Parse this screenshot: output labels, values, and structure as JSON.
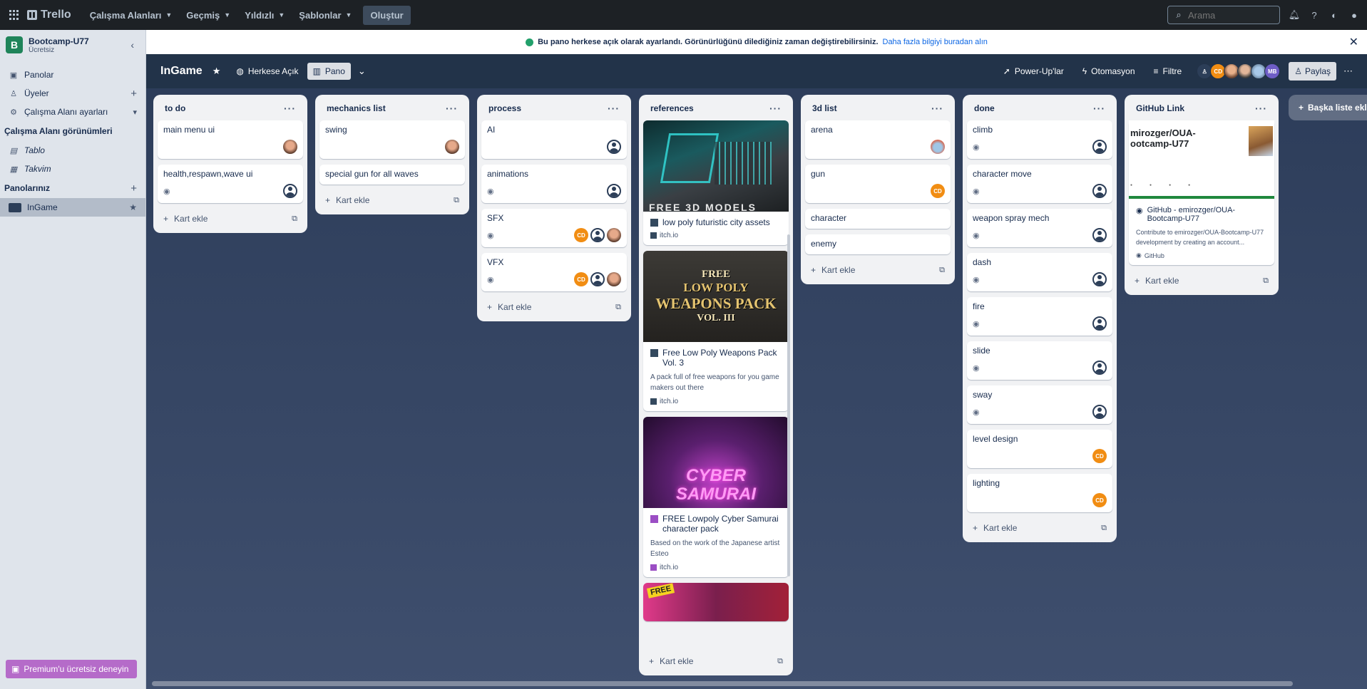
{
  "topbar": {
    "logo": "Trello",
    "nav": [
      "Çalışma Alanları",
      "Geçmiş",
      "Yıldızlı",
      "Şablonlar"
    ],
    "create": "Oluştur",
    "search_placeholder": "Arama"
  },
  "sidebar": {
    "workspace_badge": "B",
    "workspace_name": "Bootcamp-U77",
    "workspace_plan": "Ücretsiz",
    "items": [
      {
        "label": "Panolar"
      },
      {
        "label": "Üyeler"
      },
      {
        "label": "Çalışma Alanı ayarları"
      }
    ],
    "views_heading": "Çalışma Alanı görünümleri",
    "views": [
      {
        "label": "Tablo"
      },
      {
        "label": "Takvim"
      }
    ],
    "boards_heading": "Panolarınız",
    "boards": [
      {
        "label": "InGame"
      }
    ],
    "premium": "Premium'u ücretsiz deneyin"
  },
  "banner": {
    "text": "Bu pano herkese açık olarak ayarlandı. Görünürlüğünü dilediğiniz zaman değiştirebilirsiniz.",
    "link": "Daha fazla bilgiyi buradan alın"
  },
  "board": {
    "title": "InGame",
    "visibility": "Herkese Açık",
    "view": "Pano",
    "powerups": "Power-Up'lar",
    "automation": "Otomasyon",
    "filter": "Filtre",
    "share": "Paylaş",
    "avatar_cd": "CD",
    "avatar_mb": "MB"
  },
  "common": {
    "add_card": "Kart ekle",
    "add_list": "Başka liste ekleyin",
    "cd": "CD"
  },
  "lists": {
    "todo": {
      "title": "to do",
      "cards": [
        "main menu ui",
        "health,respawn,wave ui"
      ]
    },
    "mechanics": {
      "title": "mechanics list",
      "cards": [
        "swing",
        "special gun for all waves"
      ]
    },
    "process": {
      "title": "process",
      "cards": [
        "AI",
        "animations",
        "SFX",
        "VFX"
      ]
    },
    "references": {
      "title": "references",
      "cards": [
        {
          "title": "low poly futuristic city assets",
          "source": "itch.io",
          "img_text": "FREE 3D MODELS"
        },
        {
          "title": "Free Low Poly Weapons Pack Vol. 3",
          "desc": "A pack full of free weapons for you game makers out there",
          "source": "itch.io",
          "img_lines": [
            "FREE",
            "LOW POLY",
            "WEAPONS PACK",
            "VOL. III"
          ]
        },
        {
          "title": "FREE Lowpoly Cyber Samurai character pack",
          "desc": "Based on the work of the Japanese artist Esteo",
          "source": "itch.io",
          "img_lines": [
            "CYBER",
            "SAMURAI"
          ]
        },
        {
          "img_text": "FREE"
        }
      ]
    },
    "list3d": {
      "title": "3d list",
      "cards": [
        "arena",
        "gun",
        "character",
        "enemy"
      ]
    },
    "done": {
      "title": "done",
      "cards": [
        "climb",
        "character move",
        "weapon spray mech",
        "dash",
        "fire",
        "slide",
        "sway",
        "level design",
        "lighting"
      ]
    },
    "github": {
      "title": "GitHub Link",
      "preview_title": "mirozger/OUA-\nootcamp-U77",
      "card_title": "GitHub - emirozger/OUA-Bootcamp-U77",
      "card_desc": "Contribute to emirozger/OUA-Bootcamp-U77 development by creating an account...",
      "source": "GitHub"
    }
  },
  "colors": {
    "accent": "#0c66e4",
    "cd": "#f18d13",
    "workspace": "#1f845a",
    "premium": "#b56bc9"
  }
}
